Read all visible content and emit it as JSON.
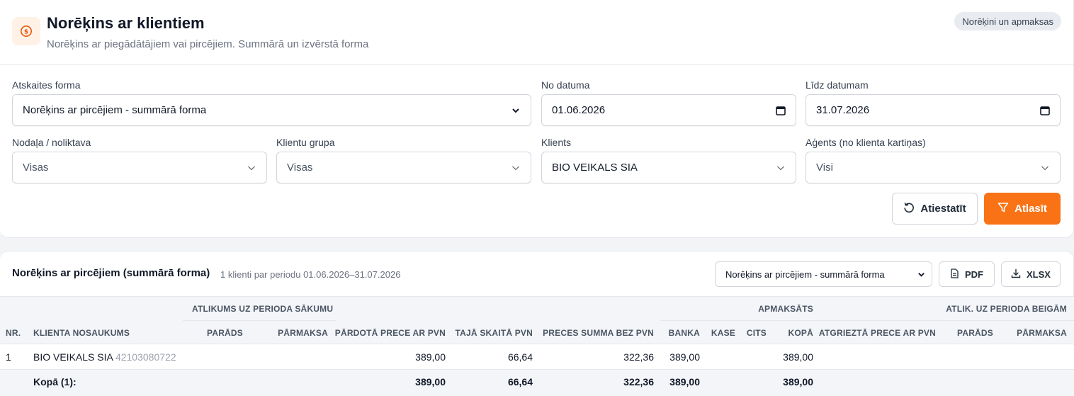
{
  "header": {
    "title": "Norēķins ar klientiem",
    "subtitle": "Norēķins ar piegādātājiem vai pircējiem. Summārā un izvērstā forma",
    "badge": "Norēķini un apmaksas",
    "accent": "#f97316"
  },
  "filters": {
    "report_form": {
      "label": "Atskaites forma",
      "value": "Norēķins ar pircējiem - summārā forma"
    },
    "date_from": {
      "label": "No datuma",
      "value": "01.06.2026"
    },
    "date_to": {
      "label": "Līdz datumam",
      "value": "31.07.2026"
    },
    "department": {
      "label": "Nodaļa / noliktava",
      "value": "Visas"
    },
    "client_group": {
      "label": "Klientu grupa",
      "value": "Visas"
    },
    "client": {
      "label": "Klients",
      "value": "BIO VEIKALS SIA"
    },
    "agent": {
      "label": "Aģents (no klienta kartiņas)",
      "value": "Visi"
    },
    "reset_label": "Atiestatīt",
    "apply_label": "Atlasīt"
  },
  "report": {
    "title": "Norēķins ar pircējiem (summārā forma)",
    "summary": "1 klienti par periodu 01.06.2026–31.07.2026",
    "form_select": "Norēķins ar pircējiem - summārā forma",
    "pdf_label": "PDF",
    "xlsx_label": "XLSX",
    "group_headers": {
      "opening": "ATLIKUMS UZ PERIODA SĀKUMU",
      "paid": "APMAKSĀTS",
      "closing": "ATLIK. UZ PERIODA BEIGĀM"
    },
    "columns": {
      "nr": "NR.",
      "client": "KLIENTA NOSAUKUMS",
      "debt_open": "PARĀDS",
      "overpay_open": "PĀRMAKSA",
      "sold_vat": "PĀRDOTĀ PRECE AR PVN",
      "incl_vat": "TAJĀ SKAITĀ PVN",
      "sum_no_vat": "PRECES SUMMA BEZ PVN",
      "bank": "BANKA",
      "cash": "KASE",
      "other": "CITS",
      "total": "KOPĀ",
      "returned_vat": "ATGRIEZTĀ PRECE AR PVN",
      "debt_close": "PARĀDS",
      "overpay_close": "PĀRMAKSA"
    },
    "rows": [
      {
        "nr": "1",
        "client": "BIO VEIKALS SIA",
        "reg_no": "42103080722",
        "sold_vat": "389,00",
        "incl_vat": "66,64",
        "sum_no_vat": "322,36",
        "bank": "389,00",
        "total": "389,00"
      }
    ],
    "totals": {
      "label": "Kopā (1):",
      "sold_vat": "389,00",
      "incl_vat": "66,64",
      "sum_no_vat": "322,36",
      "bank": "389,00",
      "total": "389,00"
    }
  }
}
